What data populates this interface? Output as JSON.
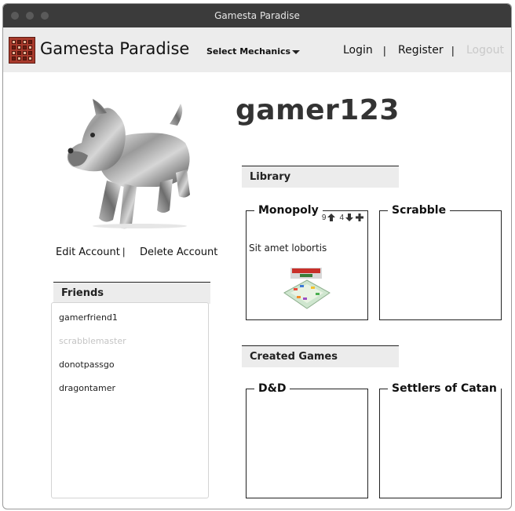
{
  "window": {
    "title": "Gamesta Paradise"
  },
  "nav": {
    "brand": "Gamesta Paradise",
    "mechanics_label": "Select Mechanics",
    "login": "Login",
    "register": "Register",
    "logout": "Logout",
    "separator": "|"
  },
  "profile": {
    "username": "gamer123",
    "edit_account": "Edit Account",
    "delete_account": "Delete Account",
    "separator": "|"
  },
  "friends": {
    "header": "Friends",
    "items": [
      {
        "name": "gamerfriend1",
        "muted": false
      },
      {
        "name": "scrabblemaster",
        "muted": true
      },
      {
        "name": "donotpassgo",
        "muted": false
      },
      {
        "name": "dragontamer",
        "muted": false
      }
    ]
  },
  "library": {
    "header": "Library",
    "games": [
      {
        "title": "Monopoly",
        "upvotes": "9",
        "downvotes": "4",
        "description": "Sit amet lobortis"
      },
      {
        "title": "Scrabble"
      }
    ]
  },
  "created": {
    "header": "Created Games",
    "games": [
      {
        "title": "D&D"
      },
      {
        "title": "Settlers of Catan"
      }
    ]
  },
  "colors": {
    "titlebar": "#3b3b3b",
    "navbar": "#ececec",
    "logo": "#a83a2c",
    "disabled_link": "#c9c9c9"
  },
  "icons": [
    "app-logo-icon",
    "chevron-down-icon",
    "arrow-up-icon",
    "arrow-down-icon",
    "plus-icon"
  ]
}
